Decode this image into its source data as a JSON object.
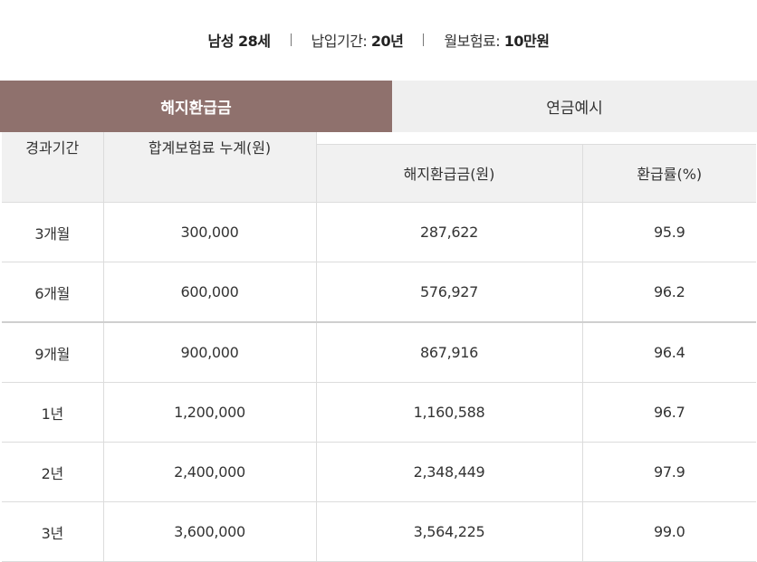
{
  "info": {
    "gender_age": "남성 28세",
    "payment_period_label": "납입기간: ",
    "payment_period_value": "20년",
    "monthly_premium_label": "월보험료: ",
    "monthly_premium_value": "10만원"
  },
  "tabs": [
    {
      "label": "해지환급금",
      "active": true
    },
    {
      "label": "연금예시",
      "active": false
    }
  ],
  "table": {
    "headers": {
      "period": "경과기간",
      "total_premium": "합계보험료 누계(원)",
      "refund_amount": "해지환급금(원)",
      "refund_rate": "환급률(%)"
    },
    "rows": [
      {
        "period": "3개월",
        "total_premium": "300,000",
        "refund_amount": "287,622",
        "refund_rate": "95.9"
      },
      {
        "period": "6개월",
        "total_premium": "600,000",
        "refund_amount": "576,927",
        "refund_rate": "96.2"
      },
      {
        "period": "9개월",
        "total_premium": "900,000",
        "refund_amount": "867,916",
        "refund_rate": "96.4"
      },
      {
        "period": "1년",
        "total_premium": "1,200,000",
        "refund_amount": "1,160,588",
        "refund_rate": "96.7"
      },
      {
        "period": "2년",
        "total_premium": "2,400,000",
        "refund_amount": "2,348,449",
        "refund_rate": "97.9"
      },
      {
        "period": "3년",
        "total_premium": "3,600,000",
        "refund_amount": "3,564,225",
        "refund_rate": "99.0"
      }
    ]
  },
  "colors": {
    "active_tab": "#8f716d",
    "inactive_tab": "#efefef",
    "header_bg": "#f1f1f1"
  }
}
